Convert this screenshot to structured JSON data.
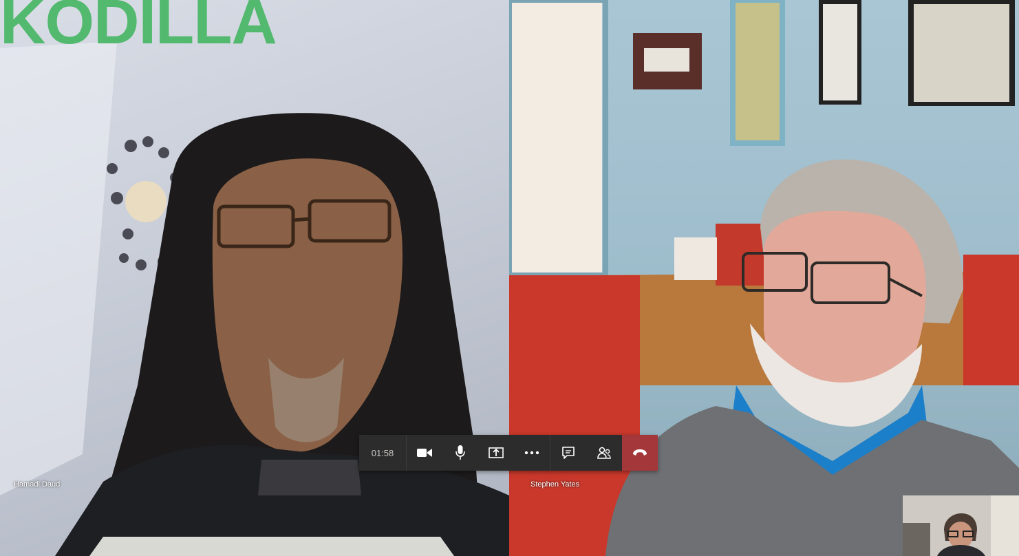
{
  "brand": {
    "logo_text": "KODILLA",
    "color": "#52b96f"
  },
  "participants": [
    {
      "name": "Hamadi Daud"
    },
    {
      "name": "Stephen Yates"
    }
  ],
  "call_controls": {
    "timer": "01:58",
    "buttons": [
      {
        "icon": "video-camera-icon"
      },
      {
        "icon": "microphone-icon"
      },
      {
        "icon": "share-screen-icon"
      },
      {
        "icon": "more-options-icon"
      },
      {
        "icon": "chat-icon"
      },
      {
        "icon": "participants-icon"
      },
      {
        "icon": "hang-up-icon"
      }
    ],
    "hangup_color": "#a4373a",
    "bar_color": "#2d2c2c"
  }
}
